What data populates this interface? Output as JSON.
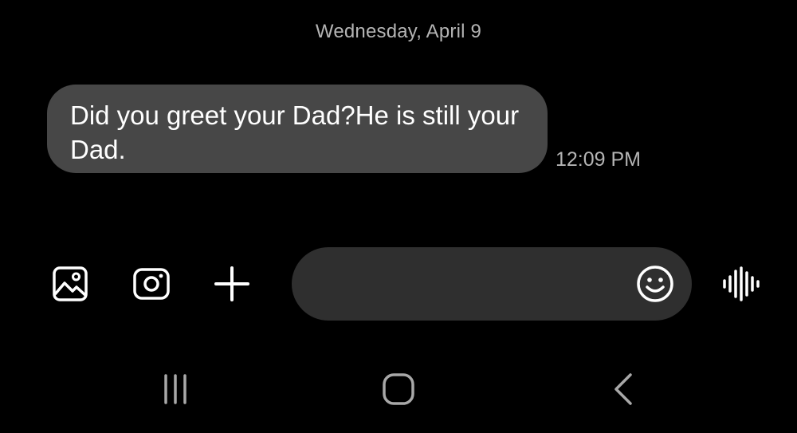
{
  "conversation": {
    "date_header": "Wednesday, April 9",
    "messages": [
      {
        "direction": "incoming",
        "text": "Did you greet your Dad?He is still your Dad.",
        "time": "12:09 PM"
      }
    ]
  },
  "composer": {
    "value": "",
    "placeholder": "",
    "left_icons": [
      "gallery-icon",
      "camera-icon",
      "plus-icon"
    ],
    "emoji_icon": "smiley-icon",
    "voice_icon": "voice-waveform-icon"
  },
  "navigation_bar": {
    "icons": [
      "recent-apps-icon",
      "home-icon",
      "back-icon"
    ]
  },
  "colors": {
    "background": "#000000",
    "incoming_bubble": "#474747",
    "composer_field": "#2f2f2f",
    "secondary_text": "#b4b4b4",
    "icon": "#ffffff",
    "nav_icon": "#a8a8a8"
  }
}
